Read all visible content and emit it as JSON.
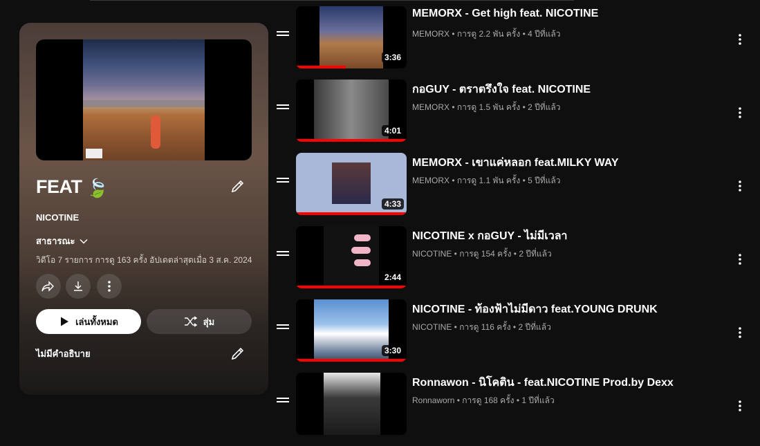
{
  "playlist": {
    "title": "FEAT",
    "title_emoji": "🍃",
    "owner": "NICOTINE",
    "privacy": "สาธารณะ",
    "meta": "วิดีโอ 7 รายการ  การดู 163 ครั้ง  อัปเดตล่าสุดเมื่อ 3 ส.ค. 2024",
    "play_all_label": "เล่นทั้งหมด",
    "shuffle_label": "สุ่ม",
    "description": "ไม่มีคำอธิบาย"
  },
  "videos": [
    {
      "title": "MEMORX - Get high feat. NICOTINE",
      "meta": "MEMORX • การดู 2.2 พัน ครั้ง • 4 ปีที่แล้ว",
      "duration": "3:36",
      "progress": 0.45
    },
    {
      "title": "กอGUY - ตราตรึงใจ feat. NICOTINE",
      "meta": "MEMORX • การดู 1.5 พัน ครั้ง • 2 ปีที่แล้ว",
      "duration": "4:01",
      "progress": 1.0
    },
    {
      "title": "MEMORX - เขาแค่หลอก feat.MILKY WAY",
      "meta": "MEMORX • การดู 1.1 พัน ครั้ง • 5 ปีที่แล้ว",
      "duration": "4:33",
      "progress": 1.0
    },
    {
      "title": "NICOTINE x กอGUY - ไม่มีเวลา",
      "meta": "NICOTINE • การดู 154 ครั้ง • 2 ปีที่แล้ว",
      "duration": "2:44",
      "progress": 1.0
    },
    {
      "title": "NICOTINE - ท้องฟ้าไม่มีดาว feat.YOUNG DRUNK",
      "meta": "NICOTINE • การดู 116 ครั้ง • 2 ปีที่แล้ว",
      "duration": "3:30",
      "progress": 1.0
    },
    {
      "title": "Ronnawon - นิโคติน - feat.NICOTINE Prod.by Dexx",
      "meta": "Ronnaworn • การดู 168 ครั้ง • 1 ปีที่แล้ว",
      "duration": "",
      "progress": 0
    }
  ],
  "colors": {
    "background": "#0f0f0f",
    "progress": "#ff0000",
    "meta_text": "#aaaaaa"
  }
}
